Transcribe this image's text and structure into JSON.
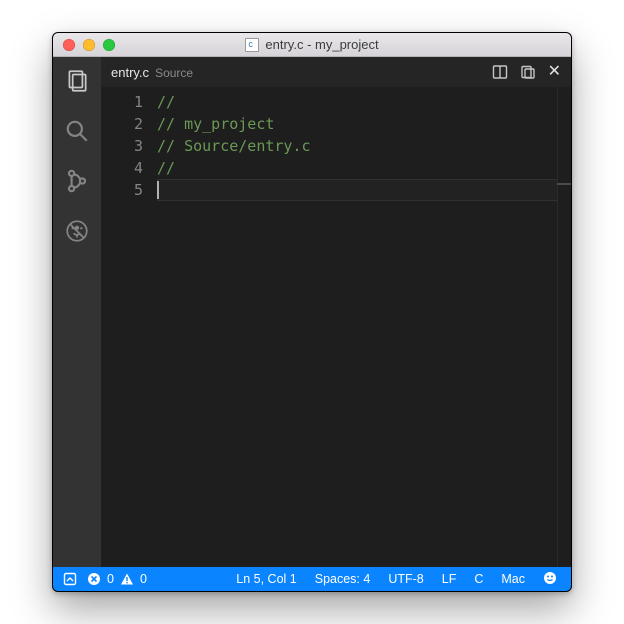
{
  "window": {
    "title": "entry.c - my_project"
  },
  "tab": {
    "filename": "entry.c",
    "folder": "Source"
  },
  "code": {
    "lines": [
      {
        "n": 1,
        "text": "//"
      },
      {
        "n": 2,
        "text": "// my_project"
      },
      {
        "n": 3,
        "text": "// Source/entry.c"
      },
      {
        "n": 4,
        "text": "//"
      },
      {
        "n": 5,
        "text": ""
      }
    ],
    "current_line": 5
  },
  "status": {
    "errors": "0",
    "warnings": "0",
    "position": "Ln 5, Col 1",
    "indent": "Spaces: 4",
    "encoding": "UTF-8",
    "eol": "LF",
    "language": "C",
    "os_label": "Mac"
  }
}
